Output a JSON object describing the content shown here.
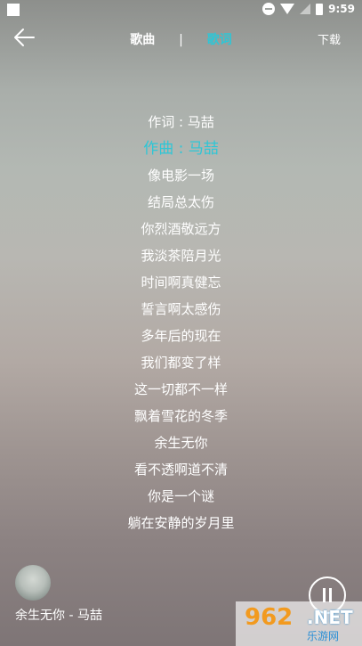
{
  "status_bar": {
    "time": "9:59"
  },
  "header": {
    "tabs": [
      {
        "label": "歌曲",
        "active": false
      },
      {
        "label": "歌词",
        "active": true
      }
    ],
    "separator": "|",
    "download_label": "下载",
    "accent_color": "#2ec6d6"
  },
  "lyrics": {
    "lines": [
      "作词 : 马喆",
      "作曲 : 马喆",
      "像电影一场",
      "结局总太伤",
      "你烈酒敬远方",
      "我淡茶陪月光",
      "时间啊真健忘",
      "誓言啊太感伤",
      "多年后的现在",
      "我们都变了样",
      "这一切都不一样",
      "飘着雪花的冬季",
      "余生无你",
      "看不透啊道不清",
      "你是一个谜",
      "躺在安静的岁月里"
    ],
    "active_index": 1
  },
  "player": {
    "title": "余生无你 - 马喆"
  },
  "watermark": {
    "number": "962",
    "domain": ".NET",
    "sub": "乐游网"
  }
}
